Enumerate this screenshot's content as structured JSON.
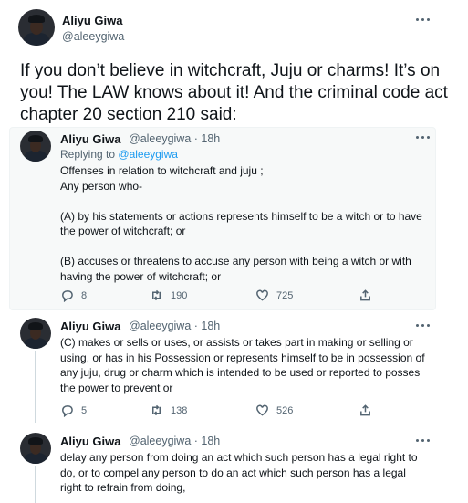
{
  "header": {
    "name": "Aliyu Giwa",
    "handle": "@aleeygiwa"
  },
  "main_tweet": {
    "text": "If you don’t believe in witchcraft, Juju or charms! It’s on you! The LAW knows about it! And the criminal code act chapter 20 section 210 said:"
  },
  "tweets": [
    {
      "name": "Aliyu Giwa",
      "handle_time": "@aleeygiwa · 18h",
      "replying_prefix": "Replying to",
      "replying_handle": "@aleeygiwa",
      "text": "Offenses in relation to witchcraft and juju ;\nAny person who-\n\n(A) by his statements or actions represents himself to be a witch or to have the power of witchcraft; or\n\n(B) accuses or threatens to accuse any person with being a witch or with having the power of witchcraft; or",
      "replies": "8",
      "retweets": "190",
      "likes": "725"
    },
    {
      "name": "Aliyu Giwa",
      "handle_time": "@aleeygiwa · 18h",
      "text": "(C) makes or sells or uses, or assists or takes part in making or selling or using, or has in his Possession or represents himself to be in possession of any juju, drug or charm which is intended to be used or reported to posses the power to prevent or",
      "replies": "5",
      "retweets": "138",
      "likes": "526"
    },
    {
      "name": "Aliyu Giwa",
      "handle_time": "@aleeygiwa · 18h",
      "text": "delay any person from doing an act which such person has a legal right to do, or to compel any person to do an act which such person has a legal right to refrain from doing,"
    }
  ],
  "icons": {
    "reply": "reply-icon",
    "retweet": "retweet-icon",
    "like": "heart-icon",
    "share": "share-icon",
    "more": "more-icon"
  },
  "colors": {
    "text": "#0f1419",
    "muted": "#536471",
    "link": "#1d9bf0",
    "quote_bg": "#f7f9f9"
  }
}
